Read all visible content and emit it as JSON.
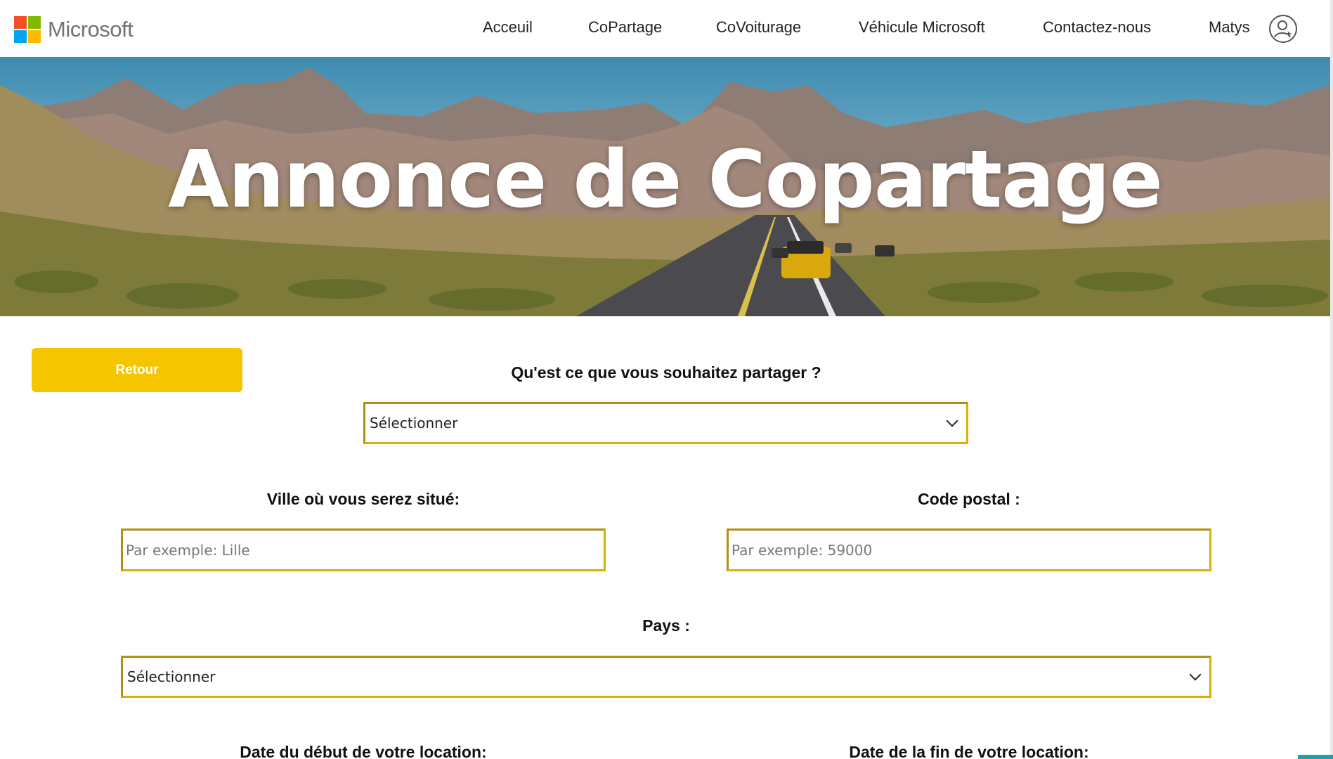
{
  "brand": {
    "name": "Microsoft",
    "logo_colors": [
      "#f25022",
      "#7fba00",
      "#00a4ef",
      "#ffb900"
    ]
  },
  "nav": {
    "items": [
      {
        "label": "Acceuil"
      },
      {
        "label": "CoPartage"
      },
      {
        "label": "CoVoiturage"
      },
      {
        "label": "Véhicule Microsoft"
      },
      {
        "label": "Contactez-nous"
      },
      {
        "label": "Matys"
      }
    ],
    "user_icon": "user-add-icon"
  },
  "hero": {
    "title": "Annonce de Copartage"
  },
  "form": {
    "back_label": "Retour",
    "share_question": "Qu'est ce que vous souhaitez partager ?",
    "share_select": "Sélectionner",
    "city_label": "Ville où vous serez situé:",
    "city_placeholder": "Par exemple: Lille",
    "postal_label": "Code postal :",
    "postal_placeholder": "Par exemple: 59000",
    "country_label": "Pays :",
    "country_select": "Sélectionner",
    "start_date_label": "Date du début de votre location:",
    "end_date_label": "Date de la fin de votre location:"
  },
  "colors": {
    "accent": "#f5c600",
    "field_border": "#d9b100"
  }
}
